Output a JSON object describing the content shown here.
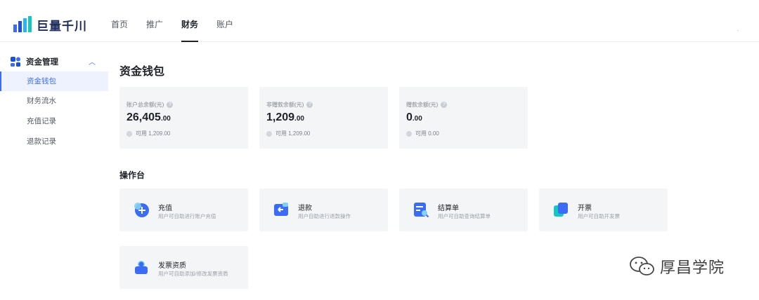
{
  "app": {
    "logo_text": "巨量千川"
  },
  "nav": {
    "items": [
      "首页",
      "推广",
      "财务",
      "账户"
    ],
    "active": "财务",
    "right_mark": "."
  },
  "sidebar": {
    "group_label": "资金管理",
    "items": [
      "资金钱包",
      "财务流水",
      "充值记录",
      "退款记录"
    ],
    "active": "资金钱包"
  },
  "page": {
    "title": "资金钱包",
    "section_title": "操作台"
  },
  "balances": [
    {
      "label": "账户总余额(元)",
      "amount_int": "26,405",
      "amount_dec": ".00",
      "available": "可用 1,209.00"
    },
    {
      "label": "非赠款余额(元)",
      "amount_int": "1,209",
      "amount_dec": ".00",
      "available": "可用 1,209.00"
    },
    {
      "label": "赠款余额(元)",
      "amount_int": "0",
      "amount_dec": ".00",
      "available": "可用 0.00"
    }
  ],
  "operations": [
    {
      "title": "充值",
      "desc": "用户可自助进行账户充值",
      "icon": "recharge-icon"
    },
    {
      "title": "退款",
      "desc": "用户自助进行退款操作",
      "icon": "refund-icon"
    },
    {
      "title": "结算单",
      "desc": "用户可自助查询结算单",
      "icon": "statement-icon"
    },
    {
      "title": "开票",
      "desc": "用户可自助开发票",
      "icon": "invoice-icon"
    },
    {
      "title": "发票资质",
      "desc": "用户可自助添加/修改发票资质",
      "icon": "invoice-qualification-icon"
    }
  ],
  "watermark": {
    "text": "厚昌学院"
  },
  "colors": {
    "accent": "#3c6cf5",
    "card_bg": "#f4f5f7",
    "active_bg": "#eef2fe"
  }
}
